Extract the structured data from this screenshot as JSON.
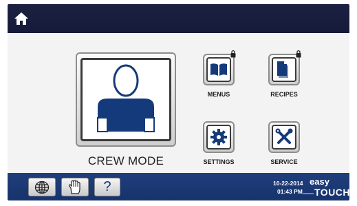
{
  "topbar": {
    "home_icon": "home-icon"
  },
  "main": {
    "crew_mode": {
      "label": "CREW MODE",
      "icon": "person-icon"
    },
    "menus": {
      "label": "MENUS",
      "icon": "book-icon",
      "locked": true
    },
    "recipes": {
      "label": "RECIPES",
      "icon": "document-icon",
      "locked": true
    },
    "settings": {
      "label": "SETTINGS",
      "icon": "gear-icon"
    },
    "service": {
      "label": "SERVICE",
      "icon": "tools-icon"
    }
  },
  "bottombar": {
    "globe_icon": "globe-icon",
    "hand_icon": "hand-icon",
    "help_label": "?",
    "date": "10-22-2014",
    "time": "01:43 PM",
    "brand_easy": "easy",
    "brand_touch": "TOUCH"
  },
  "colors": {
    "topbar": "#1c2142",
    "bottombar": "#1f3e7c",
    "icon_blue": "#143a7c"
  }
}
